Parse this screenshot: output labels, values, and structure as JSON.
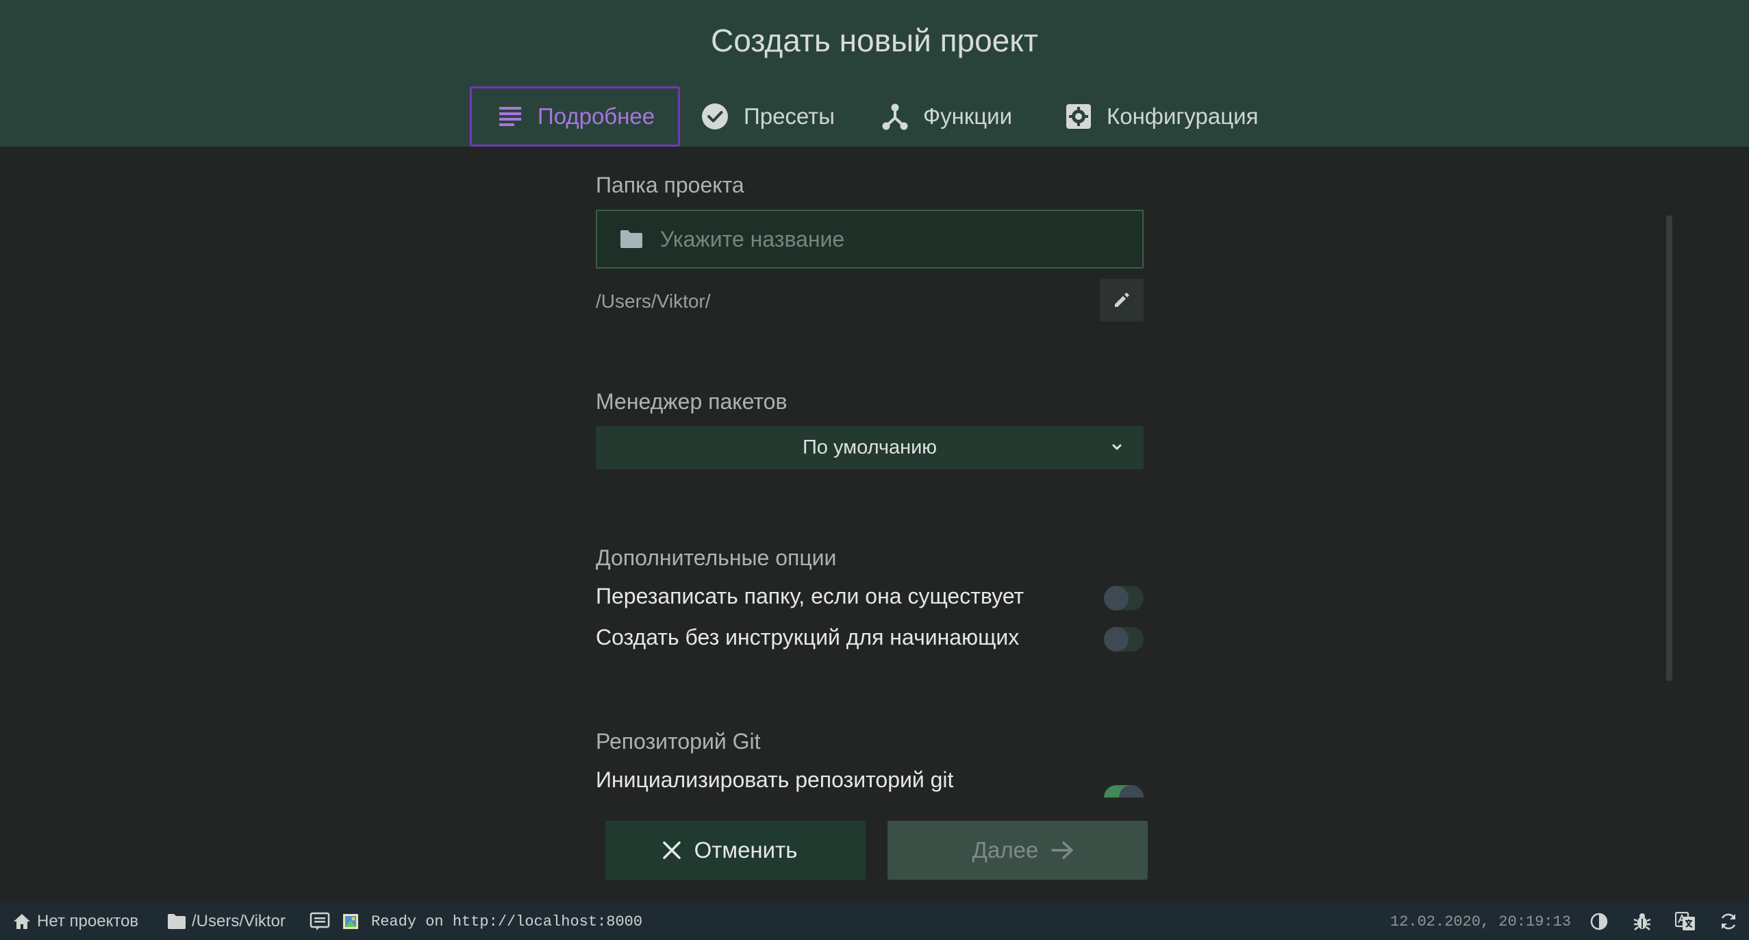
{
  "header": {
    "title": "Создать новый проект",
    "tabs": [
      {
        "label": "Подробнее",
        "icon": "list-icon",
        "active": true
      },
      {
        "label": "Пресеты",
        "icon": "check-circle-icon",
        "active": false
      },
      {
        "label": "Функции",
        "icon": "fork-icon",
        "active": false
      },
      {
        "label": "Конфигурация",
        "icon": "settings-app-icon",
        "active": false
      }
    ]
  },
  "form": {
    "folder": {
      "label": "Папка проекта",
      "placeholder": "Укажите название",
      "value": "",
      "path": "/Users/Viktor/"
    },
    "package_manager": {
      "label": "Менеджер пакетов",
      "selected": "По умолчанию"
    },
    "options": {
      "label": "Дополнительные опции",
      "items": [
        {
          "label": "Перезаписать папку, если она существует",
          "enabled": false
        },
        {
          "label": "Создать без инструкций для начинающих",
          "enabled": false
        }
      ]
    },
    "git": {
      "label": "Репозиторий Git",
      "init_label": "Инициализировать репозиторий git",
      "enabled": true
    }
  },
  "actions": {
    "cancel_label": "Отменить",
    "next_label": "Далее"
  },
  "statusbar": {
    "projects": "Нет проектов",
    "cwd": "/Users/Viktor",
    "log": "Ready on http://localhost:8000",
    "datetime": "12.02.2020, 20:19:13"
  },
  "colors": {
    "header_bg": "#2a433a",
    "body_bg": "#232525",
    "accent": "#a876e0",
    "statusbar_bg": "#1e2b33"
  }
}
